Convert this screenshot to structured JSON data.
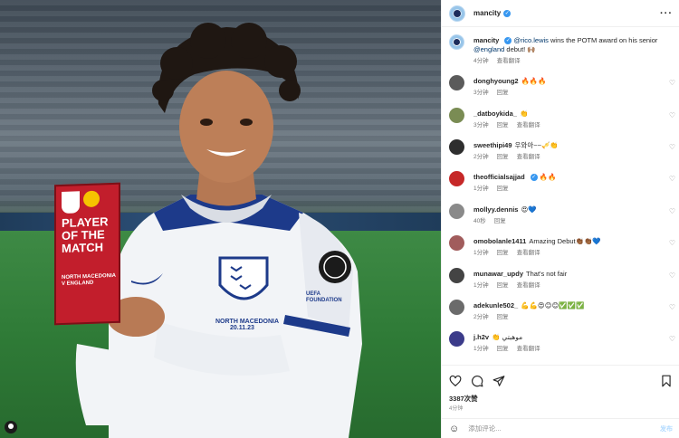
{
  "header": {
    "username": "mancity",
    "more_icon": "more-horizontal-icon"
  },
  "caption": {
    "username": "mancity",
    "mention_1": "@rico.lewis",
    "text": "wins the POTM award on his senior",
    "mention_2": "@england",
    "text_2": "debut! 🙌🏽",
    "time": "4分钟",
    "translate": "查看翻译"
  },
  "photo": {
    "trophy_title": "PLAYER OF THE MATCH",
    "trophy_subtitle": "NORTH MACEDONIA V ENGLAND",
    "shirt_text": "NORTH MACEDONIA",
    "shirt_date": "20.11.23",
    "sleeve_text": "UEFA FOUNDATION"
  },
  "comments": [
    {
      "username": "donghyoung2",
      "text": "🔥🔥🔥",
      "time": "3分钟",
      "reply": "回复",
      "translate": "",
      "avatar_color": "#5b5b5b"
    },
    {
      "username": "_datboykida_",
      "text": "👏",
      "time": "3分钟",
      "reply": "回复",
      "translate": "查看翻译",
      "avatar_color": "#7a8c54"
    },
    {
      "username": "sweethipi49",
      "text": "우와아~~🎺👏",
      "time": "2分钟",
      "reply": "回复",
      "translate": "查看翻译",
      "avatar_color": "#2e2e2e"
    },
    {
      "username": "theofficialsajjad",
      "text": "🔥🔥",
      "time": "1分钟",
      "reply": "回复",
      "translate": "",
      "avatar_color": "#c62828",
      "verified": true
    },
    {
      "username": "mollyy.dennis",
      "text": "😍💙",
      "time": "40秒",
      "reply": "回复",
      "translate": "",
      "avatar_color": "#8a8a8a"
    },
    {
      "username": "omobolanle1411",
      "text": "Amazing Debut👏🏾👏🏾💙",
      "time": "1分钟",
      "reply": "回复",
      "translate": "查看翻译",
      "avatar_color": "#a15c5c"
    },
    {
      "username": "munawar_updy",
      "text": "That's not fair",
      "time": "1分钟",
      "reply": "回复",
      "translate": "查看翻译",
      "avatar_color": "#444444"
    },
    {
      "username": "adekunle502_",
      "text": "💪💪😍😊😊✅✅✅",
      "time": "2分钟",
      "reply": "回复",
      "translate": "",
      "avatar_color": "#6b6b6b"
    },
    {
      "username": "j.h2v",
      "text": "👏 موهبتي",
      "time": "1分钟",
      "reply": "回复",
      "translate": "查看翻译",
      "avatar_color": "#3b3b8a"
    }
  ],
  "actions": {
    "likes": "3387次赞",
    "age": "4分钟"
  },
  "add_comment": {
    "placeholder": "添加评论...",
    "post": "发布"
  },
  "colors": {
    "verified": "#3797f0",
    "link": "#00376b",
    "post_disabled": "#b3dbff"
  }
}
